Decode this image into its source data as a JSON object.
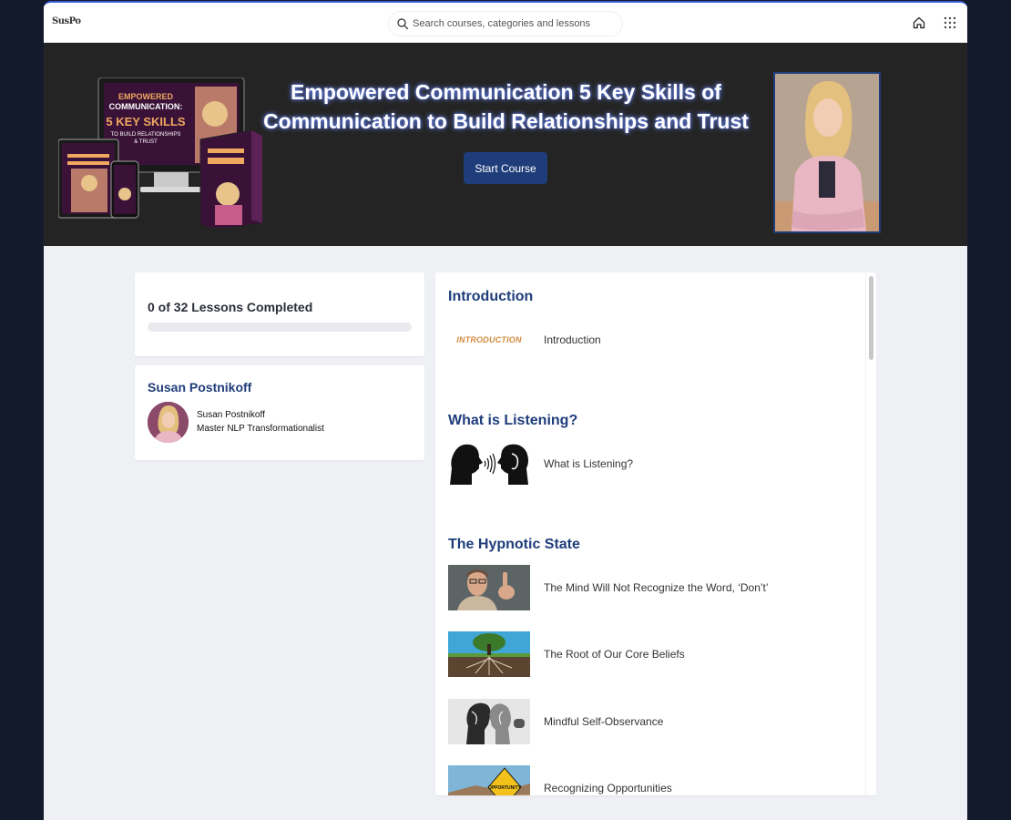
{
  "header": {
    "logo_text": "SusPo",
    "search_placeholder": "Search courses, categories and lessons",
    "home_icon": "home-icon",
    "apps_icon": "grid-icon"
  },
  "hero": {
    "title": "Empowered Communication 5 Key Skills of Communication to Build Relationships and Trust",
    "start_button": "Start Course",
    "promo_line1": "EMPOWERED",
    "promo_line2": "COMMUNICATION:",
    "promo_line3": "5 KEY SKILLS",
    "promo_line4": "TO BUILD RELATIONSHIPS",
    "promo_line5": "& TRUST",
    "title_glow_color": "#6d8cff"
  },
  "progress": {
    "text": "0 of 32 Lessons Completed",
    "completed": 0,
    "total": 32
  },
  "instructor": {
    "heading": "Susan Postnikoff",
    "name": "Susan Postnikoff",
    "role": "Master NLP Transformationalist"
  },
  "sections": [
    {
      "title": "Introduction",
      "lessons": [
        {
          "title": "Introduction",
          "thumb_label": "INTRODUCTION"
        }
      ]
    },
    {
      "title": "What is Listening?",
      "lessons": [
        {
          "title": "What is Listening?"
        }
      ]
    },
    {
      "title": "The Hypnotic State",
      "lessons": [
        {
          "title": "The Mind Will Not Recognize the Word, ‘Don’t’"
        },
        {
          "title": "The Root of Our Core Beliefs"
        },
        {
          "title": "Mindful Self-Observance"
        },
        {
          "title": "Recognizing Opportunities",
          "thumb_label": "OPPORTUNITY"
        }
      ]
    }
  ],
  "colors": {
    "accent": "#1f3d7a",
    "hero_bg": "#242424",
    "page_bg": "#eef0f4"
  }
}
